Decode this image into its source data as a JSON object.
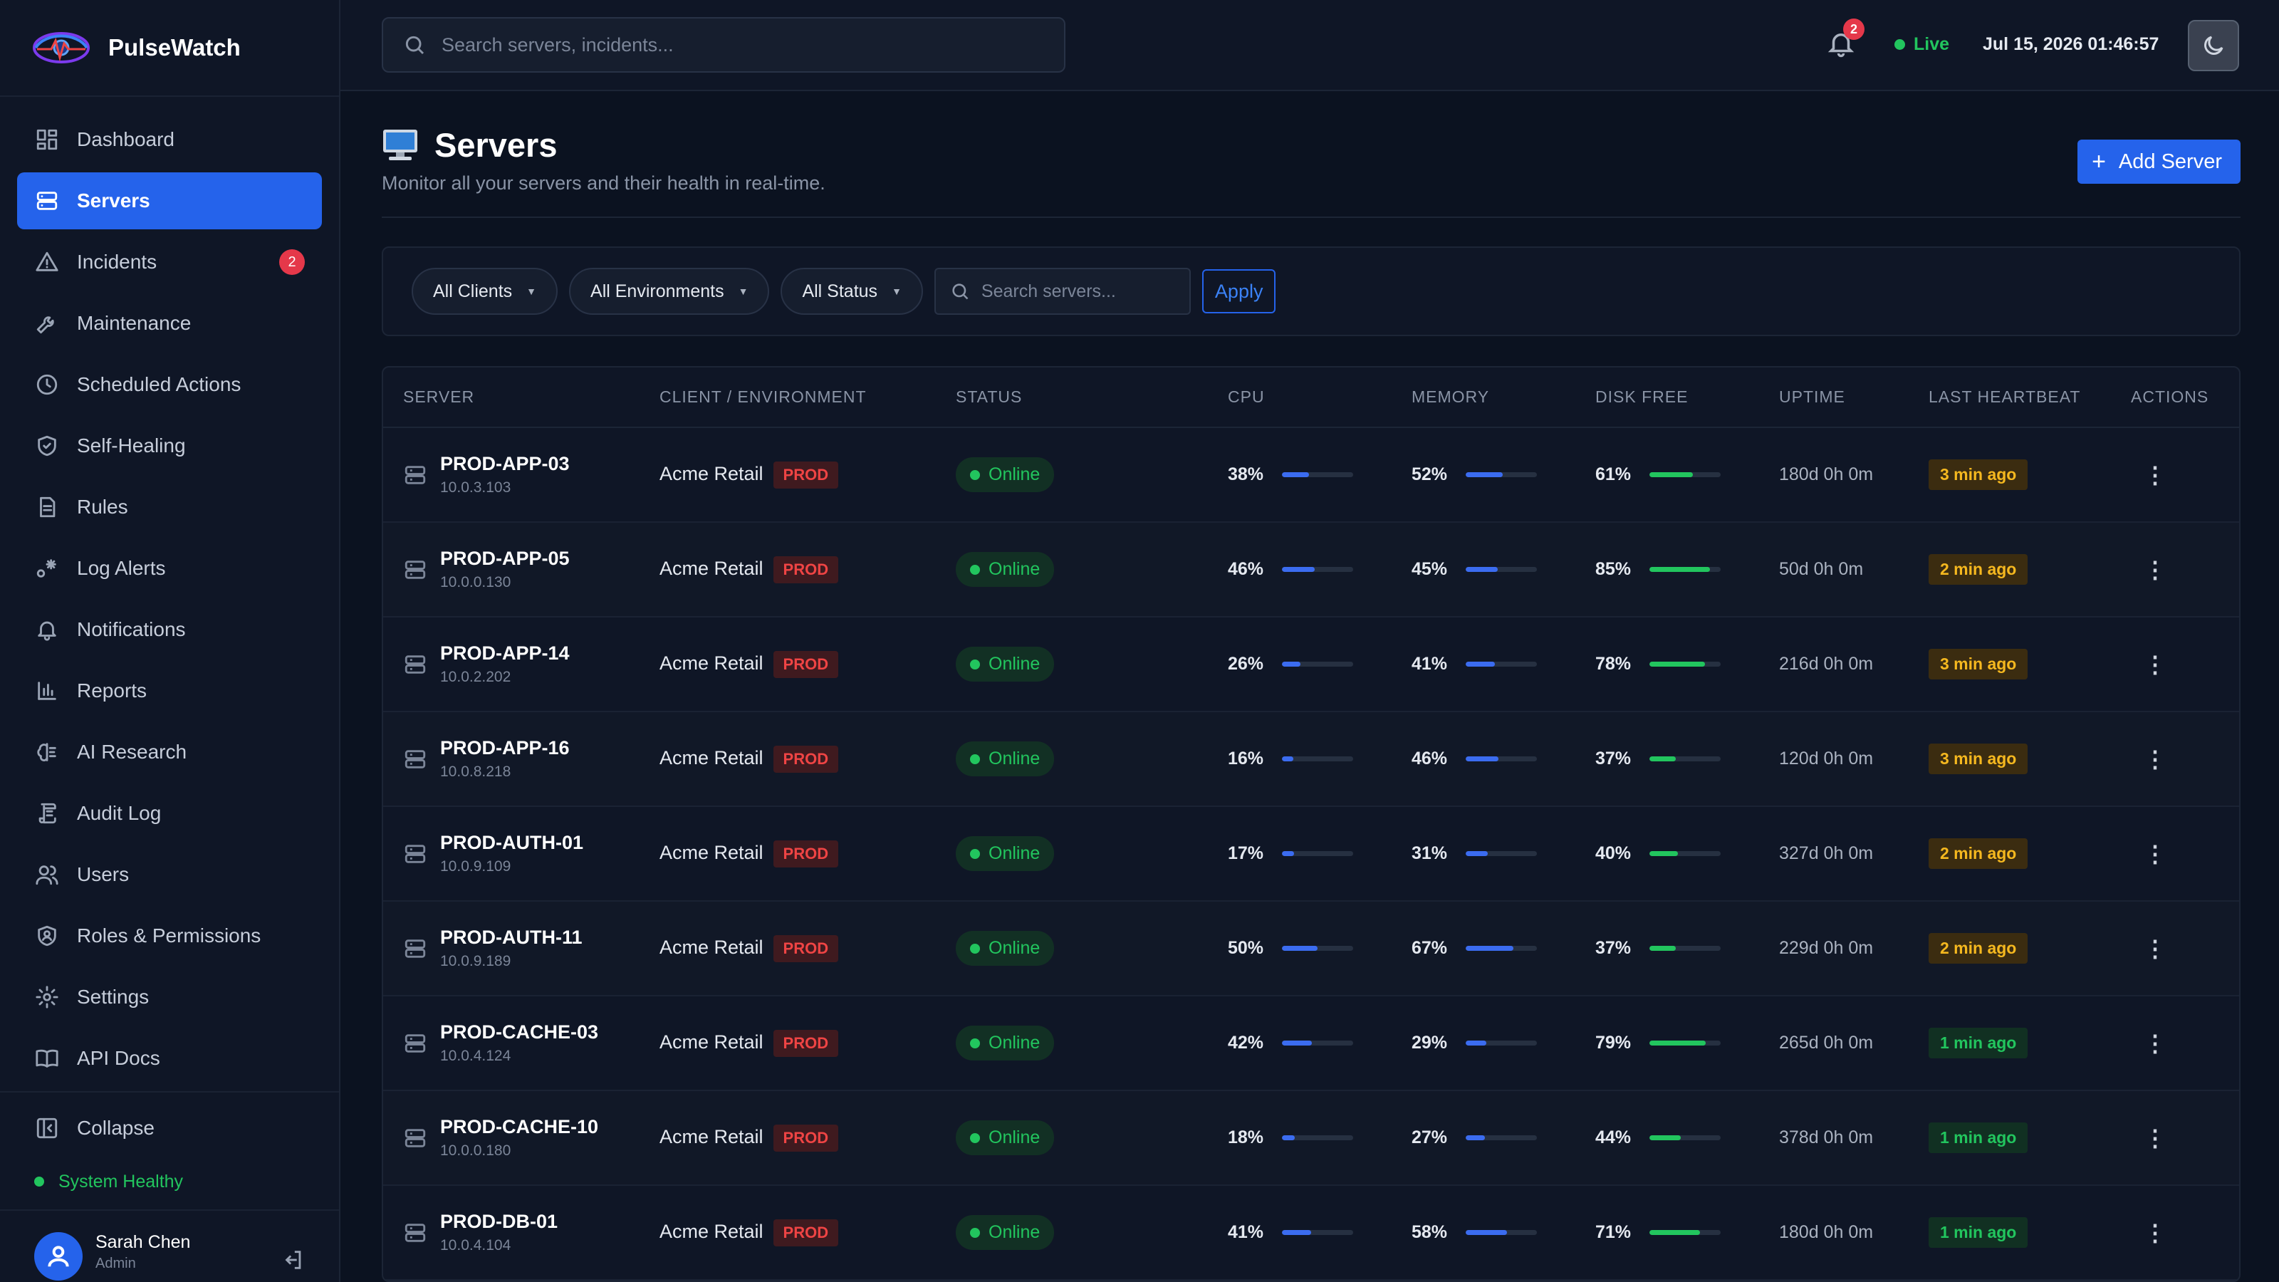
{
  "app": {
    "name": "PulseWatch"
  },
  "sidebar": {
    "items": [
      {
        "label": "Dashboard",
        "icon": "dashboard-icon",
        "active": false
      },
      {
        "label": "Servers",
        "icon": "server-icon",
        "active": true
      },
      {
        "label": "Incidents",
        "icon": "warning-icon",
        "active": false,
        "badge": "2"
      },
      {
        "label": "Maintenance",
        "icon": "wrench-icon",
        "active": false
      },
      {
        "label": "Scheduled Actions",
        "icon": "clock-icon",
        "active": false
      },
      {
        "label": "Self-Healing",
        "icon": "shield-check-icon",
        "active": false
      },
      {
        "label": "Rules",
        "icon": "document-icon",
        "active": false
      },
      {
        "label": "Log Alerts",
        "icon": "log-alert-icon",
        "active": false
      },
      {
        "label": "Notifications",
        "icon": "bell-icon",
        "active": false
      },
      {
        "label": "Reports",
        "icon": "bar-chart-icon",
        "active": false
      },
      {
        "label": "AI Research",
        "icon": "brain-icon",
        "active": false
      },
      {
        "label": "Audit Log",
        "icon": "scroll-icon",
        "active": false
      },
      {
        "label": "Users",
        "icon": "users-icon",
        "active": false
      },
      {
        "label": "Roles & Permissions",
        "icon": "shield-user-icon",
        "active": false
      },
      {
        "label": "Settings",
        "icon": "gear-icon",
        "active": false
      },
      {
        "label": "API Docs",
        "icon": "book-icon",
        "active": false
      }
    ],
    "collapse_label": "Collapse",
    "health_label": "System Healthy",
    "user": {
      "name": "Sarah Chen",
      "role": "Admin"
    }
  },
  "topbar": {
    "search_placeholder": "Search servers, incidents...",
    "notification_count": "2",
    "live_label": "Live",
    "datetime": "Jul 15, 2026 01:46:57"
  },
  "page": {
    "title": "Servers",
    "subtitle": "Monitor all your servers and their health in real-time.",
    "add_button": "Add Server"
  },
  "filters": {
    "client": "All Clients",
    "environment": "All Environments",
    "status": "All Status",
    "search_placeholder": "Search servers...",
    "apply": "Apply"
  },
  "table": {
    "headers": [
      "SERVER",
      "CLIENT / ENVIRONMENT",
      "STATUS",
      "CPU",
      "MEMORY",
      "DISK FREE",
      "UPTIME",
      "LAST HEARTBEAT",
      "ACTIONS"
    ],
    "rows": [
      {
        "name": "PROD-APP-03",
        "ip": "10.0.3.103",
        "client": "Acme Retail",
        "env": "PROD",
        "status": "Online",
        "cpu": "38%",
        "cpu_pct": 38,
        "memory": "52%",
        "mem_pct": 52,
        "disk": "61%",
        "disk_pct": 61,
        "uptime": "180d 0h 0m",
        "heartbeat": "3 min ago",
        "hb_level": "amber"
      },
      {
        "name": "PROD-APP-05",
        "ip": "10.0.0.130",
        "client": "Acme Retail",
        "env": "PROD",
        "status": "Online",
        "cpu": "46%",
        "cpu_pct": 46,
        "memory": "45%",
        "mem_pct": 45,
        "disk": "85%",
        "disk_pct": 85,
        "uptime": "50d 0h 0m",
        "heartbeat": "2 min ago",
        "hb_level": "amber"
      },
      {
        "name": "PROD-APP-14",
        "ip": "10.0.2.202",
        "client": "Acme Retail",
        "env": "PROD",
        "status": "Online",
        "cpu": "26%",
        "cpu_pct": 26,
        "memory": "41%",
        "mem_pct": 41,
        "disk": "78%",
        "disk_pct": 78,
        "uptime": "216d 0h 0m",
        "heartbeat": "3 min ago",
        "hb_level": "amber"
      },
      {
        "name": "PROD-APP-16",
        "ip": "10.0.8.218",
        "client": "Acme Retail",
        "env": "PROD",
        "status": "Online",
        "cpu": "16%",
        "cpu_pct": 16,
        "memory": "46%",
        "mem_pct": 46,
        "disk": "37%",
        "disk_pct": 37,
        "uptime": "120d 0h 0m",
        "heartbeat": "3 min ago",
        "hb_level": "amber"
      },
      {
        "name": "PROD-AUTH-01",
        "ip": "10.0.9.109",
        "client": "Acme Retail",
        "env": "PROD",
        "status": "Online",
        "cpu": "17%",
        "cpu_pct": 17,
        "memory": "31%",
        "mem_pct": 31,
        "disk": "40%",
        "disk_pct": 40,
        "uptime": "327d 0h 0m",
        "heartbeat": "2 min ago",
        "hb_level": "amber"
      },
      {
        "name": "PROD-AUTH-11",
        "ip": "10.0.9.189",
        "client": "Acme Retail",
        "env": "PROD",
        "status": "Online",
        "cpu": "50%",
        "cpu_pct": 50,
        "memory": "67%",
        "mem_pct": 67,
        "disk": "37%",
        "disk_pct": 37,
        "uptime": "229d 0h 0m",
        "heartbeat": "2 min ago",
        "hb_level": "amber"
      },
      {
        "name": "PROD-CACHE-03",
        "ip": "10.0.4.124",
        "client": "Acme Retail",
        "env": "PROD",
        "status": "Online",
        "cpu": "42%",
        "cpu_pct": 42,
        "memory": "29%",
        "mem_pct": 29,
        "disk": "79%",
        "disk_pct": 79,
        "uptime": "265d 0h 0m",
        "heartbeat": "1 min ago",
        "hb_level": "green"
      },
      {
        "name": "PROD-CACHE-10",
        "ip": "10.0.0.180",
        "client": "Acme Retail",
        "env": "PROD",
        "status": "Online",
        "cpu": "18%",
        "cpu_pct": 18,
        "memory": "27%",
        "mem_pct": 27,
        "disk": "44%",
        "disk_pct": 44,
        "uptime": "378d 0h 0m",
        "heartbeat": "1 min ago",
        "hb_level": "green"
      },
      {
        "name": "PROD-DB-01",
        "ip": "10.0.4.104",
        "client": "Acme Retail",
        "env": "PROD",
        "status": "Online",
        "cpu": "41%",
        "cpu_pct": 41,
        "memory": "58%",
        "mem_pct": 58,
        "disk": "71%",
        "disk_pct": 71,
        "uptime": "180d 0h 0m",
        "heartbeat": "1 min ago",
        "hb_level": "green"
      }
    ]
  },
  "colors": {
    "accent": "#2563eb",
    "cpu_bar": "#3b6cf0",
    "memory_bar": "#3b6cf0",
    "disk_bar": "#22c55e",
    "online": "#22c55e",
    "danger": "#ef4444"
  }
}
